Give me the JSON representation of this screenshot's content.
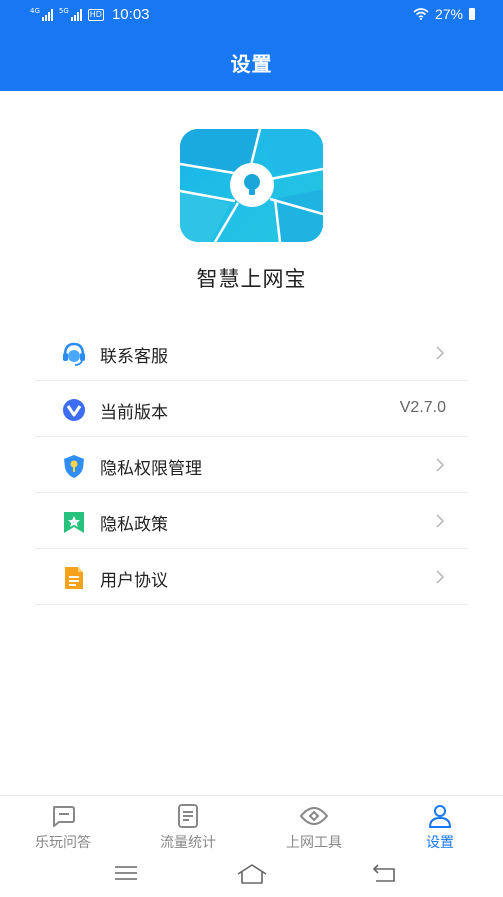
{
  "status_bar": {
    "net1": "4G",
    "net2": "5G",
    "hd": "HD",
    "time": "10:03",
    "battery": "27%",
    "icons": [
      "signal-icon",
      "signal-icon",
      "hd-icon",
      "wifi-icon",
      "battery-icon"
    ]
  },
  "header": {
    "title": "设置"
  },
  "app": {
    "name": "智慧上网宝",
    "logo_icon": "app-logo-icon"
  },
  "menu": {
    "items": [
      {
        "label": "联系客服",
        "icon": "customer-service-icon",
        "trailing": "chevron"
      },
      {
        "label": "当前版本",
        "icon": "version-icon",
        "value": "V2.7.0"
      },
      {
        "label": "隐私权限管理",
        "icon": "privacy-shield-icon",
        "trailing": "chevron"
      },
      {
        "label": "隐私政策",
        "icon": "policy-bookmark-icon",
        "trailing": "chevron"
      },
      {
        "label": "用户协议",
        "icon": "agreement-document-icon",
        "trailing": "chevron"
      }
    ]
  },
  "tabs": [
    {
      "label": "乐玩问答",
      "icon": "chat-icon",
      "active": false
    },
    {
      "label": "流量统计",
      "icon": "document-icon",
      "active": false
    },
    {
      "label": "上网工具",
      "icon": "eye-icon",
      "active": false
    },
    {
      "label": "设置",
      "icon": "user-icon",
      "active": true
    }
  ],
  "system_nav": [
    "menu-icon",
    "home-icon",
    "back-icon"
  ],
  "colors": {
    "primary": "#1877f2",
    "inactive_tab": "#888888",
    "divider": "#ececec"
  }
}
